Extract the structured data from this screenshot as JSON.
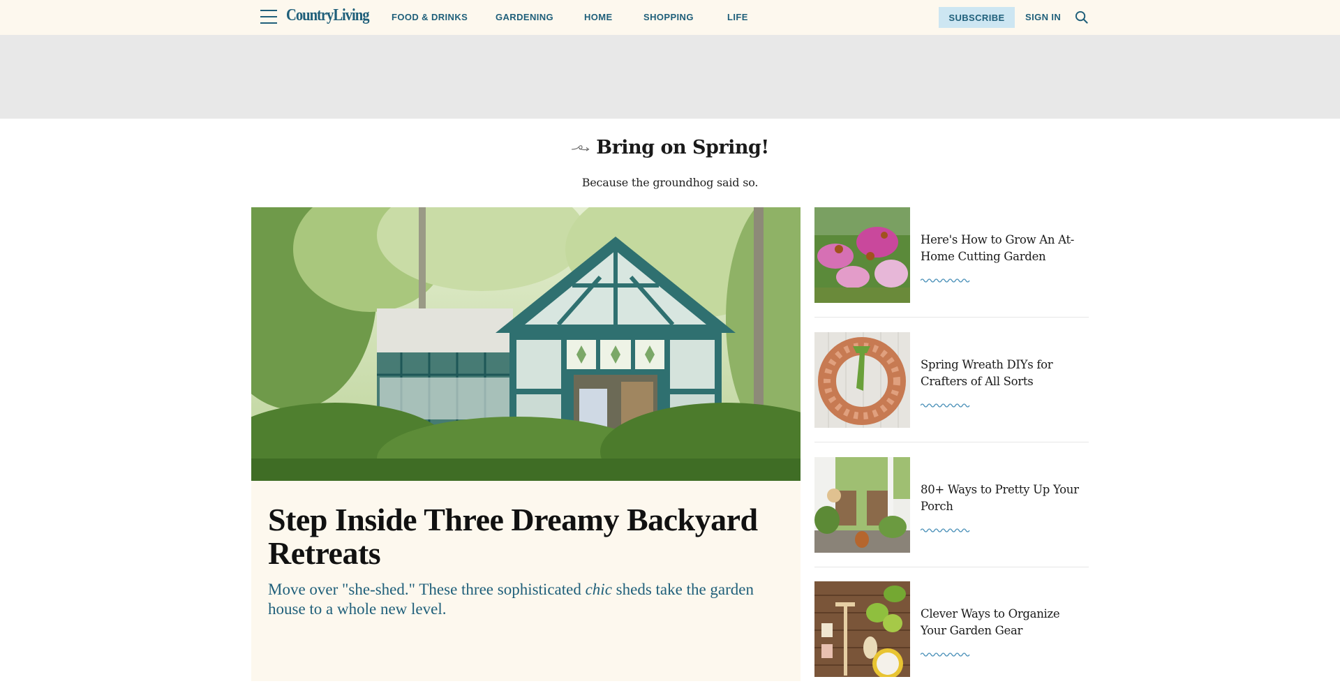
{
  "header": {
    "logo": "CountryLiving",
    "nav": [
      {
        "label": "FOOD & DRINKS"
      },
      {
        "label": "GARDENING"
      },
      {
        "label": "HOME"
      },
      {
        "label": "SHOPPING"
      },
      {
        "label": "LIFE"
      }
    ],
    "subscribe_label": "SUBSCRIBE",
    "signin_label": "SIGN IN",
    "icons": {
      "menu": "hamburger-menu-icon",
      "search": "search-icon"
    }
  },
  "section": {
    "title": "Bring on Spring!",
    "subtitle": "Because the groundhog said so.",
    "title_icon": "swirl-arrow-icon"
  },
  "hero": {
    "title": "Step Inside Three Dreamy Backyard Retreats",
    "dek_before": "Move over \"she-shed.\" These three sophisticated ",
    "dek_em": "chic",
    "dek_after": " sheds take the garden house to a whole new level.",
    "image_alt": "Teal glass greenhouse shed surrounded by trees and boxwood hedges"
  },
  "sidebar": {
    "items": [
      {
        "title": "Here's How to Grow An At-Home Cutting Garden",
        "image_alt": "Pink coneflowers and purple blooms in a garden"
      },
      {
        "title": "Spring Wreath DIYs for Crafters of All Sorts",
        "image_alt": "Terracotta pot wreath with green bow"
      },
      {
        "title": "80+ Ways to Pretty Up Your Porch",
        "image_alt": "Porch with rocking chairs, plants and a dog"
      },
      {
        "title": "Clever Ways to Organize Your Garden Gear",
        "image_alt": "Garden tools hung on a wood pallet wall"
      }
    ]
  },
  "colors": {
    "brand": "#1f5f7a",
    "header_bg": "#fdf8ee",
    "ad_bg": "#e8e8e8",
    "subscribe_bg": "#cde6f2",
    "wave": "#4a90b8"
  }
}
